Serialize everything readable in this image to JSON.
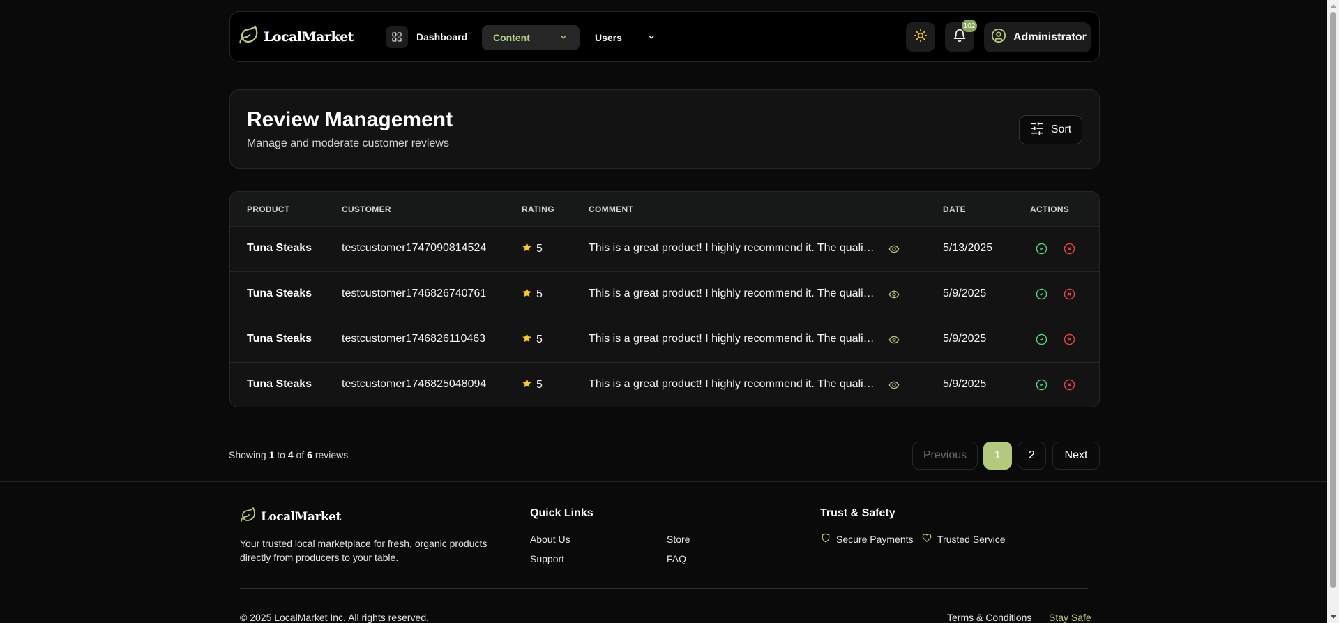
{
  "header": {
    "brand": "LocalMarket",
    "nav": {
      "dashboard": "Dashboard",
      "content": "Content",
      "users": "Users"
    },
    "notification_count": "102",
    "user_label": "Administrator"
  },
  "page": {
    "title": "Review Management",
    "subtitle": "Manage and moderate customer reviews",
    "sort_label": "Sort"
  },
  "table": {
    "columns": {
      "product": "PRODUCT",
      "customer": "CUSTOMER",
      "rating": "RATING",
      "comment": "COMMENT",
      "date": "DATE",
      "actions": "ACTIONS"
    },
    "rows": [
      {
        "product": "Tuna Steaks",
        "customer": "testcustomer1747090814524",
        "rating": "5",
        "comment": "This is a great product! I highly recommend it. The quality is excellent.",
        "date": "5/13/2025"
      },
      {
        "product": "Tuna Steaks",
        "customer": "testcustomer1746826740761",
        "rating": "5",
        "comment": "This is a great product! I highly recommend it. The quality is excellent.",
        "date": "5/9/2025"
      },
      {
        "product": "Tuna Steaks",
        "customer": "testcustomer1746826110463",
        "rating": "5",
        "comment": "This is a great product! I highly recommend it. The quality is excellent.",
        "date": "5/9/2025"
      },
      {
        "product": "Tuna Steaks",
        "customer": "testcustomer1746825048094",
        "rating": "5",
        "comment": "This is a great product! I highly recommend it. The quality is excellent.",
        "date": "5/9/2025"
      }
    ]
  },
  "pagination": {
    "showing_prefix": "Showing",
    "from": "1",
    "to_word": "to",
    "to": "4",
    "of_word": "of",
    "total": "6",
    "suffix": "reviews",
    "previous": "Previous",
    "page1": "1",
    "page2": "2",
    "next": "Next",
    "current_page": 1
  },
  "footer": {
    "brand": "LocalMarket",
    "description": "Your trusted local marketplace for fresh, organic products directly from producers to your table.",
    "quick_links_title": "Quick Links",
    "links": {
      "about": "About Us",
      "store": "Store",
      "support": "Support",
      "faq": "FAQ"
    },
    "trust_title": "Trust & Safety",
    "trust": {
      "secure": "Secure Payments",
      "trusted": "Trusted Service"
    },
    "copyright": "© 2025 LocalMarket Inc. All rights reserved.",
    "terms": "Terms & Conditions",
    "stay_safe": "Stay Safe"
  },
  "colors": {
    "accent": "#b3c97c",
    "star": "#facc15",
    "approve": "#4ade80",
    "reject": "#ef4444"
  },
  "icons": [
    "leaf-icon",
    "grid-icon",
    "chevron-down-icon",
    "sun-icon",
    "bell-icon",
    "user-circle-icon",
    "sliders-icon",
    "star-icon",
    "eye-icon",
    "check-circle-icon",
    "x-circle-icon",
    "shield-icon",
    "heart-icon"
  ]
}
